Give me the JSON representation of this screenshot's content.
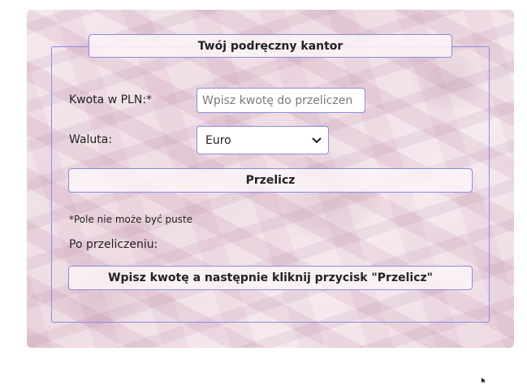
{
  "form": {
    "title": "Twój podręczny kantor",
    "amount_label": "Kwota w PLN:*",
    "amount_placeholder": "Wpisz kwotę do przeliczen",
    "amount_value": "",
    "currency_label": "Waluta:",
    "currency_selected": "Euro",
    "convert_button": "Przelicz",
    "required_note": "*Pole nie może być puste",
    "result_label": "Po przeliczeniu:",
    "result_text": "Wpisz kwotę a następnie kliknij przycisk \"Przelicz\""
  },
  "icons": {
    "select_arrow": "chevron-down-icon",
    "cursor": "mouse-cursor-icon"
  },
  "colors": {
    "border_accent": "#8c8ce0",
    "background_tint": "#f1e3ea",
    "text": "#222222"
  }
}
